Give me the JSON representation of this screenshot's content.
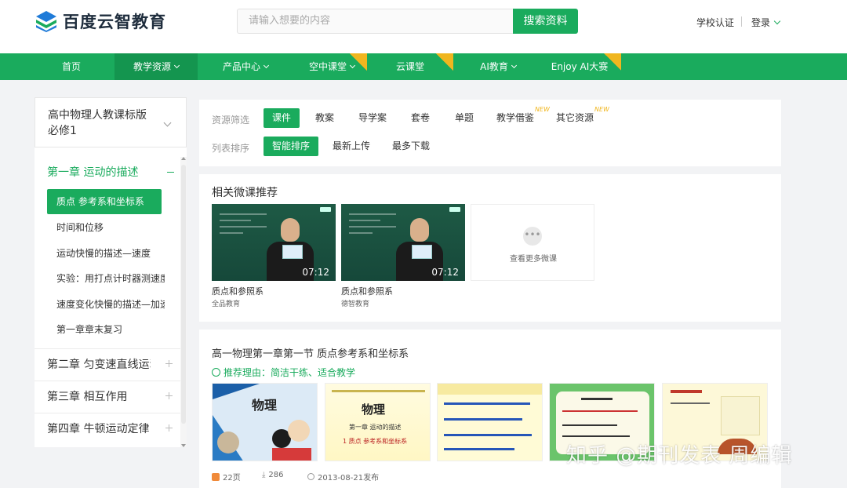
{
  "header": {
    "logo_text": "百度云智教育",
    "search_placeholder": "请输入想要的内容",
    "search_button": "搜索资料",
    "school_auth": "学校认证",
    "login": "登录"
  },
  "nav": {
    "items": [
      {
        "label": "首页"
      },
      {
        "label": "教学资源"
      },
      {
        "label": "产品中心"
      },
      {
        "label": "空中课堂"
      },
      {
        "label": "云课堂"
      },
      {
        "label": "AI教育"
      },
      {
        "label": "Enjoy AI大赛"
      }
    ]
  },
  "sidebar": {
    "book": "高中物理人教课标版 必修1",
    "chapter_active": "第一章 运动的描述",
    "lessons": [
      "质点 参考系和坐标系",
      "时间和位移",
      "运动快慢的描述—速度",
      "实验：用打点计时器测速度",
      "速度变化快慢的描述—加速度",
      "第一章章末复习"
    ],
    "chapters": [
      "第二章 匀变速直线运动",
      "第三章 相互作用",
      "第四章 牛顿运动定律"
    ]
  },
  "filters": {
    "resource_label": "资源筛选",
    "resource_types": [
      "课件",
      "教案",
      "导学案",
      "套卷",
      "单题",
      "教学借鉴",
      "其它资源"
    ],
    "new_tag": "NEW",
    "sort_label": "列表排序",
    "sort_options": [
      "智能排序",
      "最新上传",
      "最多下载"
    ]
  },
  "micro": {
    "title": "相关微课推荐",
    "videos": [
      {
        "name": "质点和参照系",
        "org": "全品教育",
        "duration": "07:12"
      },
      {
        "name": "质点和参照系",
        "org": "德智教育",
        "duration": "07:12"
      }
    ],
    "more": "查看更多微课"
  },
  "doc": {
    "title": "高一物理第一章第一节 质点参考系和坐标系",
    "reason": "推荐理由：简洁干练、适合教学",
    "pages": "22页",
    "downloads": "286",
    "published": "2013-08-21发布",
    "slide_words": {
      "physics": "物理",
      "chapter": "第一章 运动的描述",
      "section": "1 质点 参考系和坐标系"
    }
  },
  "watermark": "知乎 @期刊发表 周编辑",
  "colors": {
    "brand": "#1aab5d",
    "nav_active": "#14954f",
    "badge": "#f0b61f"
  }
}
